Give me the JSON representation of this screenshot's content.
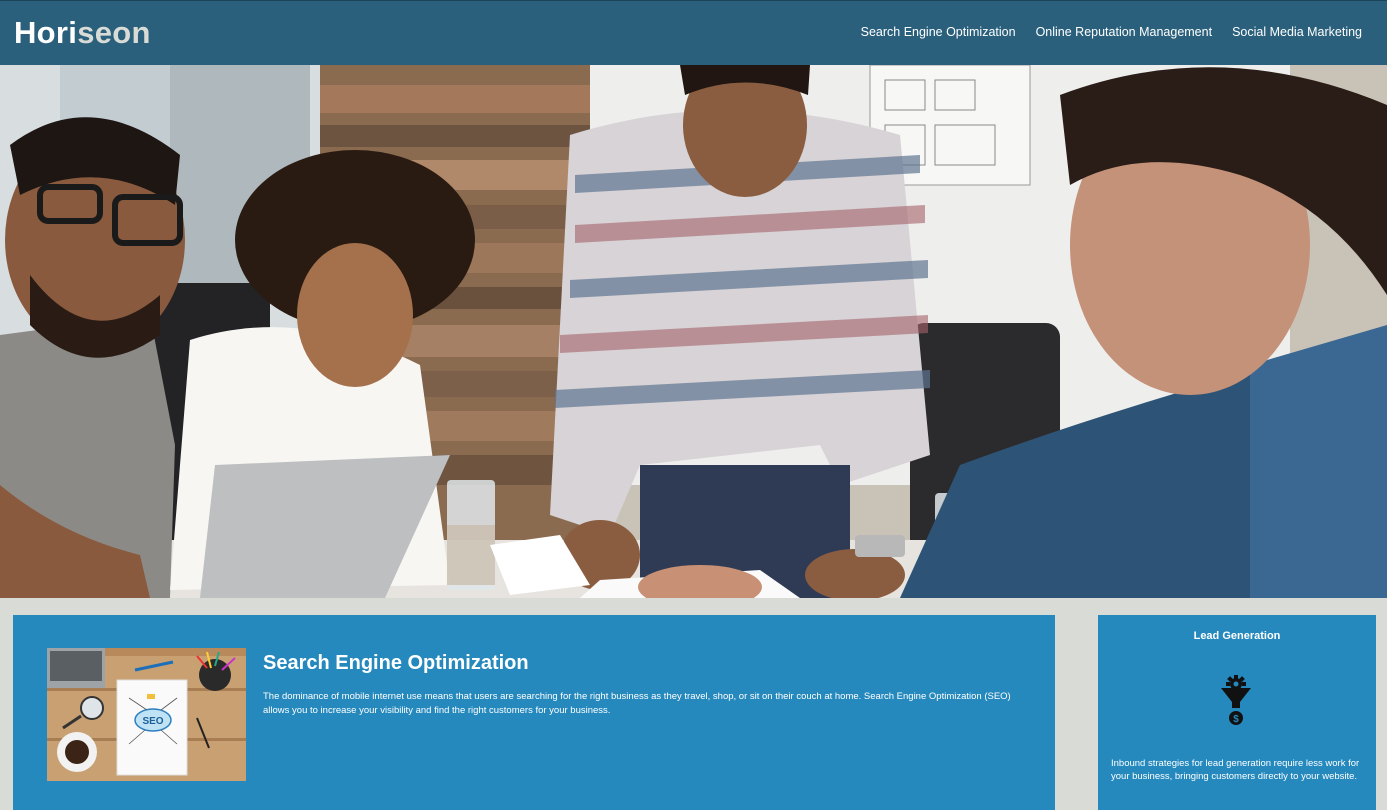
{
  "header": {
    "logo_main": "Hori",
    "logo_accent": "seon",
    "nav": [
      {
        "label": "Search Engine Optimization"
      },
      {
        "label": "Online Reputation Management"
      },
      {
        "label": "Social Media Marketing"
      }
    ]
  },
  "hero": {
    "image_icon": "team-meeting-photo"
  },
  "main": {
    "seo_card": {
      "image_icon": "seo-notebook-photo",
      "title": "Search Engine Optimization",
      "text": "The dominance of mobile internet use means that users are searching for the right business as they travel, shop, or sit on their couch at home. Search Engine Optimization (SEO) allows you to increase your visibility and find the right customers for your business."
    }
  },
  "aside": {
    "lead_generation": {
      "title": "Lead Generation",
      "icon": "lead-funnel-icon",
      "text": "Inbound strategies for lead generation require less work for your business, bringing customers directly to your website."
    }
  },
  "colors": {
    "header_bg": "#2a607c",
    "card_bg": "#2589bd",
    "page_bg": "#d9dcd6",
    "logo_accent": "#d9dcd6"
  }
}
